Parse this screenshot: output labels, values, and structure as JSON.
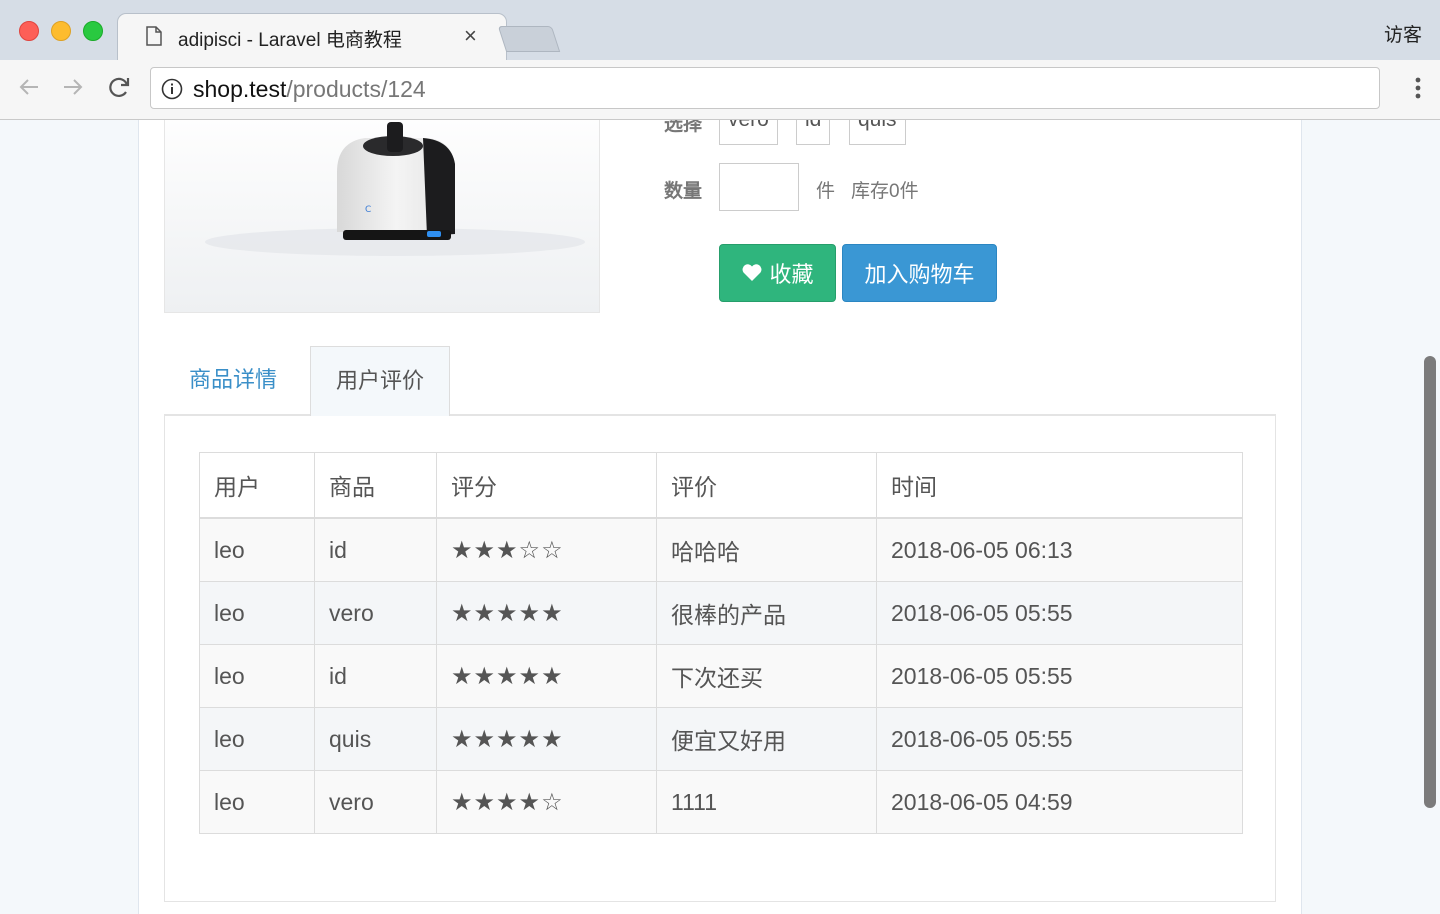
{
  "browser": {
    "tab_title": "adipisci - Laravel 电商教程",
    "tab_close": "×",
    "url_host": "shop.test",
    "url_path": "/products/124",
    "guest_label": "访客"
  },
  "product": {
    "sku_label": "选择",
    "skus": [
      "vero",
      "id",
      "quis"
    ],
    "qty_label": "数量",
    "qty_value": "",
    "unit": "件",
    "stock_text": "库存0件",
    "fav_button": "收藏",
    "cart_button": "加入购物车"
  },
  "tabs": [
    {
      "label": "商品详情",
      "active": false
    },
    {
      "label": "用户评价",
      "active": true
    }
  ],
  "reviews": {
    "headers": [
      "用户",
      "商品",
      "评分",
      "评价",
      "时间"
    ],
    "rows": [
      {
        "user": "leo",
        "sku": "id",
        "stars": "★★★☆☆",
        "rating": 3,
        "comment": "哈哈哈",
        "time": "2018-06-05 06:13"
      },
      {
        "user": "leo",
        "sku": "vero",
        "stars": "★★★★★",
        "rating": 5,
        "comment": "很棒的产品",
        "time": "2018-06-05 05:55"
      },
      {
        "user": "leo",
        "sku": "id",
        "stars": "★★★★★",
        "rating": 5,
        "comment": "下次还买",
        "time": "2018-06-05 05:55"
      },
      {
        "user": "leo",
        "sku": "quis",
        "stars": "★★★★★",
        "rating": 5,
        "comment": "便宜又好用",
        "time": "2018-06-05 05:55"
      },
      {
        "user": "leo",
        "sku": "vero",
        "stars": "★★★★☆",
        "rating": 4,
        "comment": "1111",
        "time": "2018-06-05 04:59"
      }
    ]
  },
  "colors": {
    "fav_button": "#2fb57d",
    "cart_button": "#3a97d4",
    "tab_link": "#3a8fc8"
  }
}
